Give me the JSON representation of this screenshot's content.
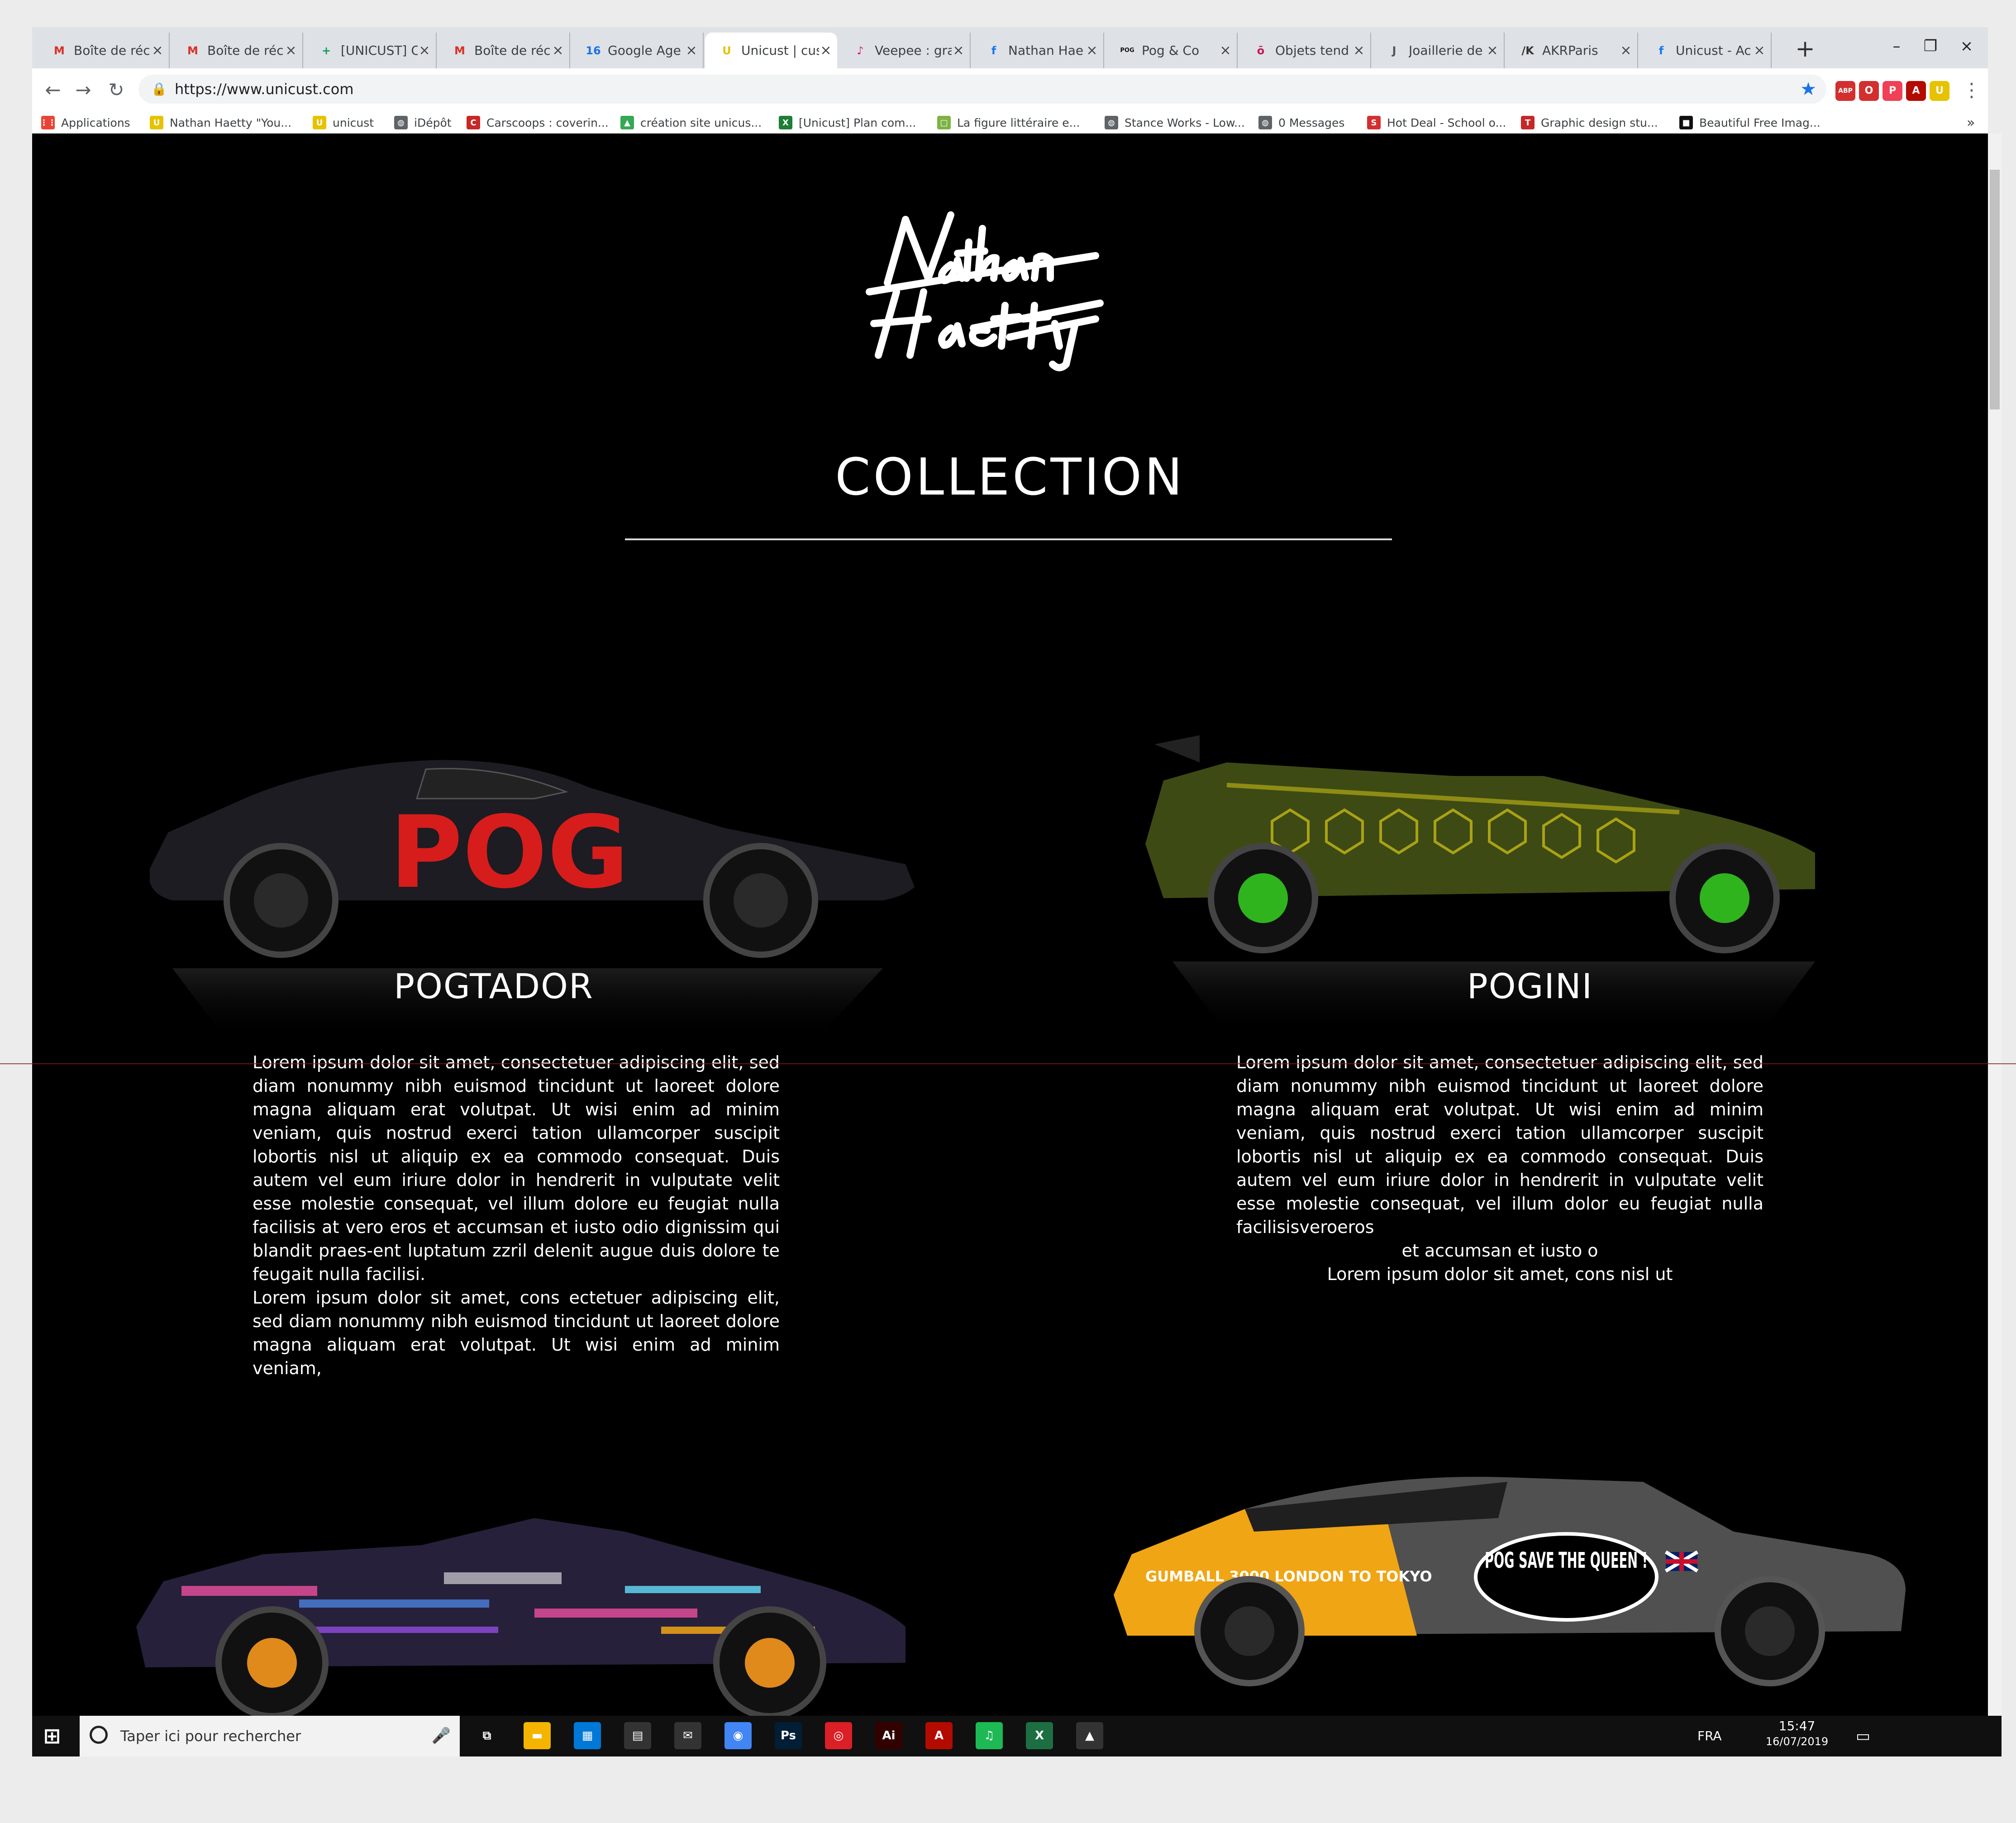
{
  "browser": {
    "tabs": [
      {
        "icon": "gmail-icon",
        "icon_char": "M",
        "icon_color": "#d93025",
        "title": "Boîte de réc"
      },
      {
        "icon": "gmail-icon",
        "icon_char": "M",
        "icon_color": "#d93025",
        "title": "Boîte de réc"
      },
      {
        "icon": "sheets-icon",
        "icon_char": "+",
        "icon_color": "#0f9d58",
        "title": "[UNICUST] C"
      },
      {
        "icon": "gmail-icon",
        "icon_char": "M",
        "icon_color": "#d93025",
        "title": "Boîte de réc"
      },
      {
        "icon": "calendar-icon",
        "icon_char": "16",
        "icon_color": "#1a73e8",
        "title": "Google Age"
      },
      {
        "icon": "unicust-icon",
        "icon_char": "U",
        "icon_color": "#e6c200",
        "title": "Unicust | cus"
      },
      {
        "icon": "veepee-icon",
        "icon_char": "♪",
        "icon_color": "#e0177d",
        "title": "Veepee : gra"
      },
      {
        "icon": "facebook-icon",
        "icon_char": "f",
        "icon_color": "#1877f2",
        "title": "Nathan Hae"
      },
      {
        "icon": "pog-icon",
        "icon_char": "POG",
        "icon_color": "#111111",
        "title": "Pog & Co"
      },
      {
        "icon": "objets-icon",
        "icon_char": "ō",
        "icon_color": "#c2185b",
        "title": "Objets tend"
      },
      {
        "icon": "joaillerie-icon",
        "icon_char": "J",
        "icon_color": "#555555",
        "title": "Joaillerie de"
      },
      {
        "icon": "akr-icon",
        "icon_char": "/K",
        "icon_color": "#333333",
        "title": "AKRParis"
      },
      {
        "icon": "facebook-icon",
        "icon_char": "f",
        "icon_color": "#1877f2",
        "title": "Unicust - Ac"
      }
    ],
    "active_tab_index": 5,
    "close_glyph": "×",
    "new_tab_glyph": "+",
    "window_controls": {
      "minimize": "–",
      "restore": "❐",
      "close": "×"
    },
    "nav": {
      "back": "←",
      "forward": "→",
      "reload": "↻",
      "lock": "🔒",
      "star": "★"
    },
    "url": "https://www.unicust.com",
    "extensions": [
      {
        "name": "abp-icon",
        "label": "ABP",
        "color": "#d32f2f"
      },
      {
        "name": "opera-addon-icon",
        "label": "O",
        "color": "#d32f2f"
      },
      {
        "name": "pocket-icon",
        "label": "P",
        "color": "#ef4056"
      },
      {
        "name": "acrobat-icon",
        "label": "A",
        "color": "#b30b00"
      },
      {
        "name": "unicust-ext-icon",
        "label": "U",
        "color": "#e6c200"
      }
    ],
    "menu_glyph": "⋮",
    "bookmarks": [
      {
        "icon": "apps-icon",
        "icon_char": "⋮⋮",
        "icon_color": "#ea4335",
        "label": "Applications"
      },
      {
        "icon": "unicust-icon",
        "icon_char": "U",
        "icon_color": "#e6c200",
        "label": "Nathan Haetty \"You..."
      },
      {
        "icon": "unicust-icon",
        "icon_char": "U",
        "icon_color": "#e6c200",
        "label": "unicust"
      },
      {
        "icon": "globe-icon",
        "icon_char": "◍",
        "icon_color": "#5f6368",
        "label": "iDépôt"
      },
      {
        "icon": "carscoops-icon",
        "icon_char": "C",
        "icon_color": "#c62828",
        "label": "Carscoops : coverin..."
      },
      {
        "icon": "drive-icon",
        "icon_char": "▲",
        "icon_color": "#34a853",
        "label": "création site unicus..."
      },
      {
        "icon": "excel-icon",
        "icon_char": "X",
        "icon_color": "#1e7e34",
        "label": "[Unicust] Plan com..."
      },
      {
        "icon": "bookmark-green-icon",
        "icon_char": "□",
        "icon_color": "#7cb342",
        "label": "La figure littéraire e..."
      },
      {
        "icon": "globe-icon",
        "icon_char": "◍",
        "icon_color": "#5f6368",
        "label": "Stance Works - Low..."
      },
      {
        "icon": "globe-icon",
        "icon_char": "◍",
        "icon_color": "#5f6368",
        "label": "0 Messages"
      },
      {
        "icon": "hotdeal-icon",
        "icon_char": "S",
        "icon_color": "#d32f2f",
        "label": "Hot Deal - School o..."
      },
      {
        "icon": "tp-icon",
        "icon_char": "T",
        "icon_color": "#c62828",
        "label": "Graphic design stu..."
      },
      {
        "icon": "unsplash-icon",
        "icon_char": "■",
        "icon_color": "#111111",
        "label": "Beautiful Free Imag..."
      }
    ],
    "bookmarks_more": "»"
  },
  "page": {
    "logo_text": "Nathan Haetty",
    "heading": "COLLECTION",
    "cars": [
      {
        "name": "POGTADOR",
        "body_color": "#1c1c22",
        "accent_color": "#d71c1c",
        "paragraphs": [
          "Lorem ipsum dolor sit amet, consectetuer adipiscing elit, sed diam nonummy nibh euismod tincidunt ut laoreet dolore magna aliquam erat volutpat. Ut wisi enim ad minim veniam, quis nostrud exerci tation ullamcorper suscipit lobortis nisl ut aliquip ex ea commodo consequat. Duis autem vel eum iriure dolor in hendrerit in vulputate velit esse molestie consequat, vel illum dolore eu feugiat nulla facilisis at vero eros et accumsan et iusto odio dignissim qui blandit praes-ent luptatum zzril delenit augue duis dolore te feugait nulla facilisi.",
          "Lorem ipsum dolor sit amet, cons ectetuer adipiscing elit, sed diam nonummy nibh euismod tincidunt ut laoreet dolore magna aliquam erat volutpat. Ut wisi enim ad minim veniam,"
        ]
      },
      {
        "name": "POGINI",
        "body_color": "#3e4a14",
        "accent_color": "#c4b814",
        "paragraphs": [
          "Lorem ipsum dolor sit amet, consectetuer adipiscing elit, sed diam nonummy nibh euismod tincidunt ut laoreet dolore magna aliquam erat volutpat. Ut wisi enim ad minim veniam, quis nostrud exerci tation ullamcorper suscipit lobortis nisl ut aliquip ex ea commodo consequat. Duis autem vel eum iriure dolor in hendrerit in vulputate velit esse molestie consequat, vel illum dolor eu feugiat nulla facilisisveroeros",
          "et accumsan et iusto o",
          "Lorem ipsum dolor sit amet, cons  nisl ut"
        ]
      },
      {
        "name": "",
        "body_color": "#26203a",
        "accent_color": "#b0467a",
        "paragraphs": []
      },
      {
        "name": "",
        "body_color": "#505050",
        "accent_color": "#f0a514",
        "livery_small": "GUMBALL 3000 LONDON TO TOKYO",
        "livery_big": "POG SAVE THE QUEEN !",
        "paragraphs": []
      }
    ]
  },
  "taskbar": {
    "start_glyph": "⊞",
    "search_placeholder": "Taper ici pour rechercher",
    "apps": [
      {
        "name": "task-view-icon",
        "label": "⧉",
        "color": "#101010"
      },
      {
        "name": "file-explorer-icon",
        "label": "▬",
        "color": "#f4b400"
      },
      {
        "name": "store-icon",
        "label": "▦",
        "color": "#0078d7"
      },
      {
        "name": "calculator-icon",
        "label": "▤",
        "color": "#333333"
      },
      {
        "name": "mail-icon",
        "label": "✉",
        "color": "#333333"
      },
      {
        "name": "chrome-icon",
        "label": "◉",
        "color": "#4285f4"
      },
      {
        "name": "photoshop-icon",
        "label": "Ps",
        "color": "#001e36"
      },
      {
        "name": "creative-cloud-icon",
        "label": "◎",
        "color": "#da1f26"
      },
      {
        "name": "illustrator-icon",
        "label": "Ai",
        "color": "#330000"
      },
      {
        "name": "acrobat-taskbar-icon",
        "label": "A",
        "color": "#b30b00"
      },
      {
        "name": "spotify-icon",
        "label": "♫",
        "color": "#1db954"
      },
      {
        "name": "excel-taskbar-icon",
        "label": "X",
        "color": "#1d6f42"
      },
      {
        "name": "photos-icon",
        "label": "▲",
        "color": "#333333"
      }
    ],
    "language": "FRA",
    "time": "15:47",
    "date": "16/07/2019"
  }
}
